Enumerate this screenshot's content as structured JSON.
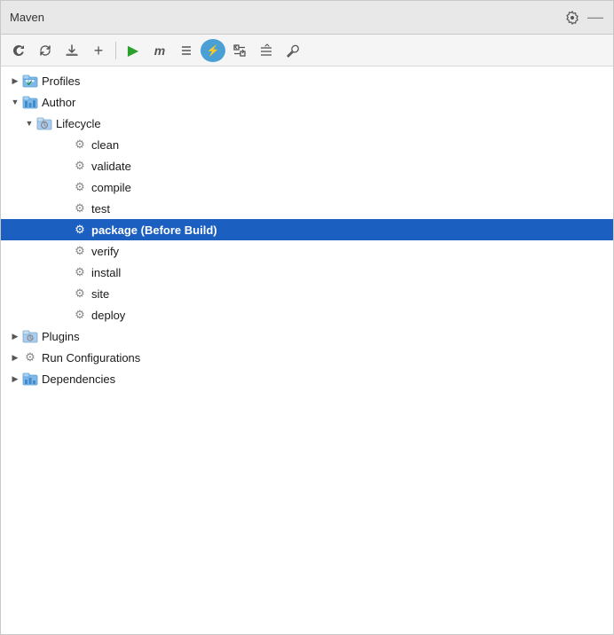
{
  "window": {
    "title": "Maven"
  },
  "toolbar": {
    "buttons": [
      {
        "id": "refresh",
        "icon": "↻",
        "label": "Refresh"
      },
      {
        "id": "refresh-alt",
        "icon": "⟳",
        "label": "Reload"
      },
      {
        "id": "download",
        "icon": "⬇",
        "label": "Download"
      },
      {
        "id": "add",
        "icon": "+",
        "label": "Add"
      },
      {
        "id": "play",
        "icon": "▶",
        "label": "Run"
      },
      {
        "id": "maven",
        "icon": "m",
        "label": "Maven"
      },
      {
        "id": "toggle",
        "icon": "⊕",
        "label": "Toggle"
      },
      {
        "id": "lightning",
        "icon": "⚡",
        "label": "Lightning"
      },
      {
        "id": "expand",
        "icon": "⇕",
        "label": "Expand"
      },
      {
        "id": "collapse",
        "icon": "⇓",
        "label": "Collapse"
      },
      {
        "id": "wrench",
        "icon": "🔧",
        "label": "Settings"
      }
    ]
  },
  "tree": {
    "items": [
      {
        "id": "profiles",
        "label": "Profiles",
        "indent": 0,
        "arrow": "right",
        "icon": "folder-blue",
        "selected": false
      },
      {
        "id": "author",
        "label": "Author",
        "indent": 0,
        "arrow": "down",
        "icon": "folder-build",
        "selected": false
      },
      {
        "id": "lifecycle",
        "label": "Lifecycle",
        "indent": 1,
        "arrow": "down",
        "icon": "folder-gear",
        "selected": false
      },
      {
        "id": "clean",
        "label": "clean",
        "indent": 2,
        "arrow": "none",
        "icon": "gear",
        "selected": false
      },
      {
        "id": "validate",
        "label": "validate",
        "indent": 2,
        "arrow": "none",
        "icon": "gear",
        "selected": false
      },
      {
        "id": "compile",
        "label": "compile",
        "indent": 2,
        "arrow": "none",
        "icon": "gear",
        "selected": false
      },
      {
        "id": "test",
        "label": "test",
        "indent": 2,
        "arrow": "none",
        "icon": "gear",
        "selected": false
      },
      {
        "id": "package",
        "label": "package (Before Build)",
        "indent": 2,
        "arrow": "none",
        "icon": "gear",
        "selected": true
      },
      {
        "id": "verify",
        "label": "verify",
        "indent": 2,
        "arrow": "none",
        "icon": "gear",
        "selected": false
      },
      {
        "id": "install",
        "label": "install",
        "indent": 2,
        "arrow": "none",
        "icon": "gear",
        "selected": false
      },
      {
        "id": "site",
        "label": "site",
        "indent": 2,
        "arrow": "none",
        "icon": "gear",
        "selected": false
      },
      {
        "id": "deploy",
        "label": "deploy",
        "indent": 2,
        "arrow": "none",
        "icon": "gear",
        "selected": false
      },
      {
        "id": "plugins",
        "label": "Plugins",
        "indent": 0,
        "arrow": "right",
        "icon": "folder-gear",
        "selected": false
      },
      {
        "id": "run-configurations",
        "label": "Run Configurations",
        "indent": 0,
        "arrow": "right",
        "icon": "gear",
        "selected": false
      },
      {
        "id": "dependencies",
        "label": "Dependencies",
        "indent": 0,
        "arrow": "right",
        "icon": "folder-chart",
        "selected": false
      }
    ]
  },
  "icons": {
    "gear": "⚙",
    "settings": "⚙",
    "close": "—"
  }
}
